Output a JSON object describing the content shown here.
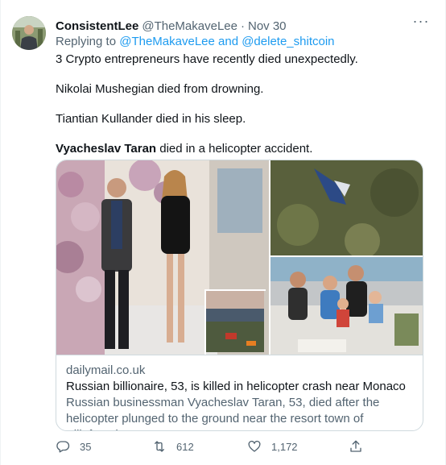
{
  "tweet": {
    "author_name": "ConsistentLee",
    "author_handle": "@TheMakaveLee",
    "separator": "·",
    "date": "Nov 30",
    "more_icon": "more-horizontal-icon",
    "reply_prefix": "Replying to",
    "reply_targets": "@TheMakaveLee and @delete_shitcoin",
    "lines": [
      "3 Crypto entrepreneurs have recently died unexpectedly.",
      "Nikolai Mushegian died from drowning.",
      "Tiantian Kullander died in his sleep."
    ],
    "last_line_bold": "Vyacheslav Taran",
    "last_line_rest": " died in a helicopter accident."
  },
  "card": {
    "domain": "dailymail.co.uk",
    "headline": "Russian billionaire, 53, is killed in helicopter crash near Monaco",
    "description": "Russian businessman Vyacheslav Taran, 53, died after the helicopter plunged to the ground near the resort town of Villefranche-sur-Mer ..."
  },
  "actions": {
    "reply_count": "35",
    "retweet_count": "612",
    "like_count": "1,172"
  },
  "colors": {
    "link": "#1d9bf0",
    "secondary_text": "#536471",
    "primary_text": "#0f1419",
    "border": "#cfd9de"
  }
}
